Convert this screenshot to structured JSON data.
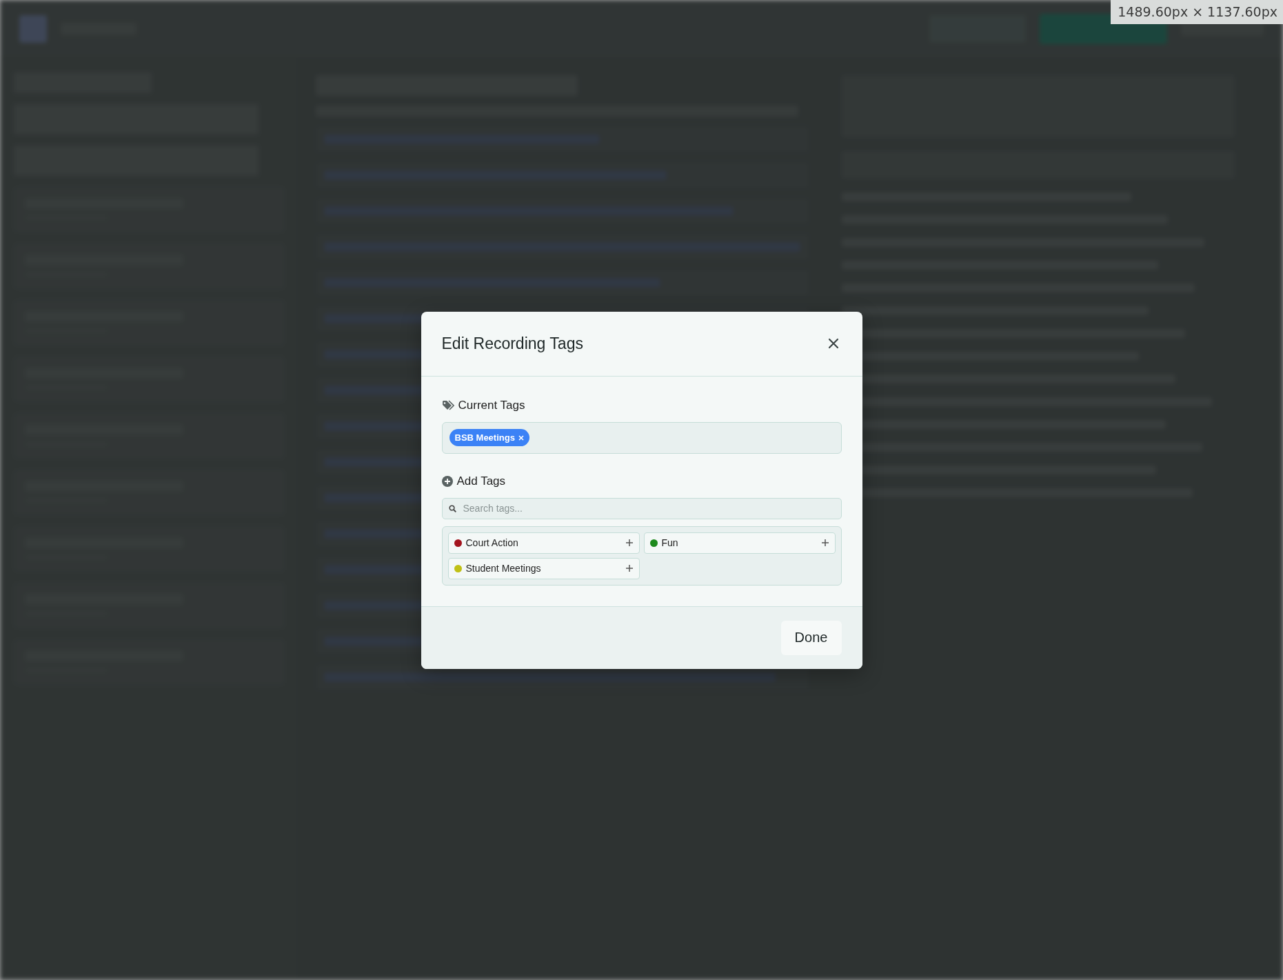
{
  "size_badge": "1489.60px × 1137.60px",
  "dialog": {
    "title": "Edit Recording Tags",
    "current_tags": {
      "label": "Current Tags",
      "tags": [
        {
          "name": "BSB Meetings"
        }
      ]
    },
    "add_tags": {
      "label": "Add Tags",
      "search": {
        "placeholder": "Search tags..."
      },
      "options": [
        {
          "name": "Court Action",
          "color": "#a3141e"
        },
        {
          "name": "Fun",
          "color": "#1d8a1d"
        },
        {
          "name": "Student Meetings",
          "color": "#c0c015"
        }
      ]
    },
    "done_button": "Done"
  }
}
